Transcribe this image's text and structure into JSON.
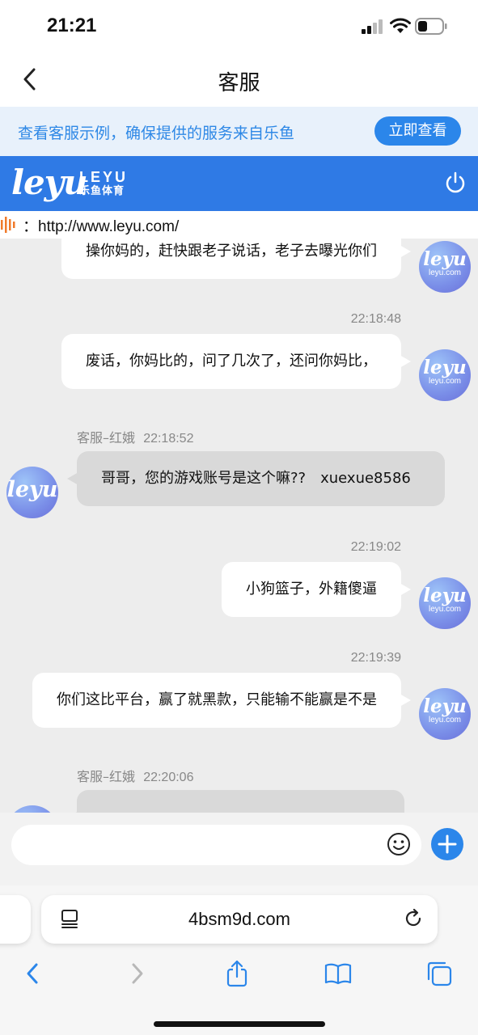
{
  "status_bar": {
    "time": "21:21"
  },
  "nav": {
    "title": "客服"
  },
  "promo": {
    "text": "查看客服示例，确保提供的服务来自乐鱼",
    "button": "立即查看"
  },
  "brand": {
    "logo": "leyu",
    "name_en": "LEYU",
    "name_cn": "乐鱼体育"
  },
  "url_bar": {
    "text": "：http://www.leyu.com/"
  },
  "avatar": {
    "logo": "leyu",
    "domain": "leyu.com"
  },
  "messages": [
    {
      "from": "me",
      "text": "操你妈的，赶快跟老子说话，老子去曝光你们"
    },
    {
      "from": "me",
      "time": "22:18:48",
      "text": "废话，你妈比的，问了几次了，还问你妈比，"
    },
    {
      "from": "agent",
      "sender": "客服–红娥",
      "time": "22:18:52",
      "text": "哥哥，您的游戏账号是这个嘛??　xuexue8586"
    },
    {
      "from": "me",
      "time": "22:19:02",
      "text": "小狗篮子，外籍傻逼"
    },
    {
      "from": "me",
      "time": "22:19:39",
      "text": "你们这比平台，赢了就黑款，只能输不能赢是不是"
    },
    {
      "from": "agent",
      "sender": "客服–红娥",
      "time": "22:20:06",
      "text": ""
    }
  ],
  "composer": {
    "placeholder": ""
  },
  "browser": {
    "address": "4bsm9d.com"
  },
  "icons": [
    "back-icon",
    "power-icon",
    "emoji-icon",
    "plus-icon",
    "reader-icon",
    "reload-icon",
    "nav-back-icon",
    "nav-forward-icon",
    "share-icon",
    "bookmarks-icon",
    "tabs-icon"
  ],
  "colors": {
    "accent": "#2b86ea",
    "brand_bar": "#2f7ae5",
    "promo_bg": "#e8f1fb"
  }
}
